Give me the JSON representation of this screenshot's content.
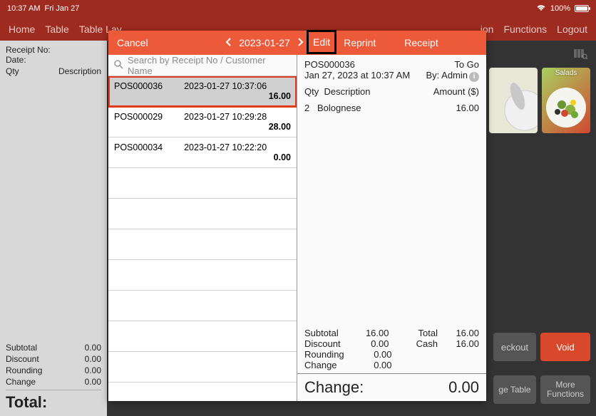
{
  "status": {
    "time": "10:37 AM",
    "date": "Fri Jan 27",
    "battery": "100%"
  },
  "menu": {
    "home": "Home",
    "table": "Table",
    "layout": "Table Lay",
    "func": "Functions",
    "logout": "Logout",
    "ion": "ion"
  },
  "left_receipt": {
    "receipt_no_label": "Receipt No:",
    "date_label": "Date:",
    "qty_label": "Qty",
    "desc_label": "Description",
    "subtotal_label": "Subtotal",
    "subtotal": "0.00",
    "discount_label": "Discount",
    "discount": "0.00",
    "rounding_label": "Rounding",
    "rounding": "0.00",
    "change_label": "Change",
    "change": "0.00",
    "total_label": "Total:"
  },
  "modal_header": {
    "cancel": "Cancel",
    "date": "2023-01-27",
    "edit": "Edit",
    "reprint": "Reprint",
    "receipt": "Receipt"
  },
  "search": {
    "placeholder": "Search by Receipt No / Customer Name"
  },
  "receipts": [
    {
      "no": "POS000036",
      "ts": "2023-01-27 10:37:06",
      "amt": "16.00",
      "selected": true
    },
    {
      "no": "POS000029",
      "ts": "2023-01-27 10:29:28",
      "amt": "28.00",
      "selected": false
    },
    {
      "no": "POS000034",
      "ts": "2023-01-27 10:22:20",
      "amt": "0.00",
      "selected": false
    }
  ],
  "detail": {
    "no": "POS000036",
    "type": "To Go",
    "datetime": "Jan 27, 2023 at 10:37 AM",
    "by_label": "By: Admin",
    "qty_label": "Qty",
    "desc_label": "Description",
    "amount_label": "Amount ($)",
    "items": [
      {
        "qty": "2",
        "desc": "Bolognese",
        "amt": "16.00"
      }
    ],
    "subtotal_label": "Subtotal",
    "subtotal": "16.00",
    "discount_label": "Discount",
    "discount": "0.00",
    "rounding_label": "Rounding",
    "rounding": "0.00",
    "change_label": "Change",
    "change": "0.00",
    "total_label": "Total",
    "total": "16.00",
    "cash_label": "Cash",
    "cash": "16.00",
    "big_change_label": "Change:",
    "big_change": "0.00"
  },
  "products": {
    "salads": "Salads"
  },
  "buttons": {
    "checkout": "eckout",
    "void": "Void",
    "table": "ge Table",
    "more1": "More",
    "more2": "Functions"
  }
}
